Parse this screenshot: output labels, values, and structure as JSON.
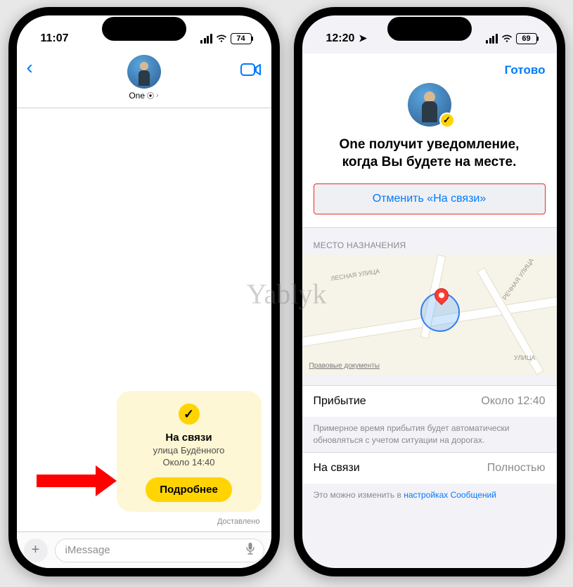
{
  "watermark": "Yablyk",
  "left": {
    "status": {
      "time": "11:07",
      "battery": "74"
    },
    "header": {
      "contact_name": "One",
      "back_btn": "‹"
    },
    "card": {
      "title": "На связи",
      "street": "улица Будённого",
      "eta": "Около 14:40",
      "details_btn": "Подробнее"
    },
    "delivered_label": "Доставлено",
    "input": {
      "placeholder": "iMessage"
    }
  },
  "right": {
    "status": {
      "time": "12:20",
      "battery": "69"
    },
    "done_btn": "Готово",
    "headline_l1": "One получит уведомление,",
    "headline_l2": "когда Вы будете на месте.",
    "cancel_btn": "Отменить «На связи»",
    "dest_label": "МЕСТО НАЗНАЧЕНИЯ",
    "map": {
      "legal": "Правовые документы",
      "street1": "ЛЕСНАЯ УЛИЦА",
      "street2": "РЕЧНАЯ УЛИЦА",
      "street3": "УЛИЦА"
    },
    "arrival": {
      "label": "Прибытие",
      "value": "Около 12:40"
    },
    "arrival_note": "Примерное время прибытия будет автоматически обновляться с учетом ситуации на дорогах.",
    "checkin": {
      "label": "На связи",
      "value": "Полностью"
    },
    "checkin_note_pre": "Это можно изменить в ",
    "checkin_note_link": "настройках Сообщений"
  }
}
